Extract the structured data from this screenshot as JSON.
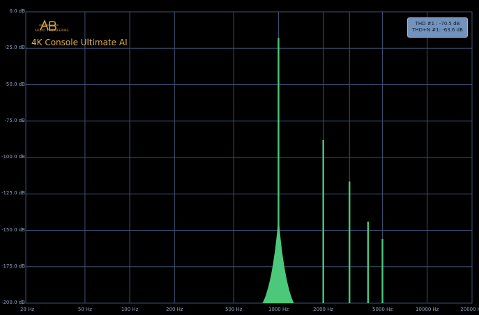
{
  "chart_data": {
    "type": "bar",
    "title": "",
    "xlabel": "",
    "ylabel": "",
    "xscale": "log",
    "xlim": [
      20,
      20000
    ],
    "ylim": [
      -200,
      0
    ],
    "grid": true,
    "x_ticks": [
      "20 Hz",
      "50 Hz",
      "100 Hz",
      "200 Hz",
      "500 Hz",
      "1000 Hz",
      "2000 Hz",
      "5000 Hz",
      "10000 Hz",
      "20000 Hz"
    ],
    "x_tick_values": [
      20,
      50,
      100,
      200,
      500,
      1000,
      2000,
      5000,
      10000,
      20000
    ],
    "x_minor_grid_values": [
      3000
    ],
    "y_ticks": [
      "0.0 dB",
      "-25.0 dB",
      "-50.0 dB",
      "-75.0 dB",
      "-100.0 dB",
      "-125.0 dB",
      "-150.0 dB",
      "-175.0 dB",
      "-200.0 dB"
    ],
    "y_tick_values": [
      0,
      -25,
      -50,
      -75,
      -100,
      -125,
      -150,
      -175,
      -200
    ],
    "series": [
      {
        "color": "#4cc87a",
        "points": [
          {
            "x": 1000,
            "y": -18
          },
          {
            "x": 2000,
            "y": -88
          },
          {
            "x": 3000,
            "y": -116.5
          },
          {
            "x": 4000,
            "y": -144
          },
          {
            "x": 5000,
            "y": -156
          }
        ]
      }
    ],
    "fundamental_skirt": {
      "center_hz": 1000,
      "base_hz_low": 780,
      "base_hz_high": 1270,
      "peak_db": -140
    },
    "colors": {
      "background": "#000000",
      "grid": "#3d5275",
      "bar": "#4cc87a",
      "tick_text": "#8ea3c4"
    }
  },
  "branding": {
    "logo_label": "AUDIO ENGINEERING",
    "product_name": "4K Console Ultimate AI"
  },
  "measurements": {
    "thd": "THD #1 : -70.5 dB",
    "thd_n": "THD+N #1: -63.6 dB"
  }
}
